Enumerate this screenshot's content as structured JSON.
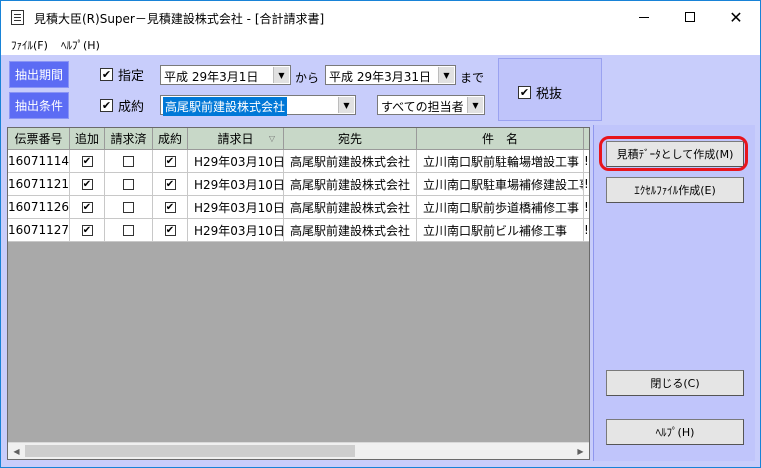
{
  "window": {
    "title": "見積大臣(R)Super－見積建設株式会社 - [合計請求書]"
  },
  "menu": {
    "file": "ﾌｧｲﾙ(F)",
    "help": "ﾍﾙﾌﾟ(H)"
  },
  "filters": {
    "period_label": "抽出期間",
    "condition_label": "抽出条件",
    "specify_label": "指定",
    "specify_checked": "✔",
    "from_date": "平成 29年3月1日",
    "from_text": "から",
    "to_date": "平成 29年3月31日",
    "until_text": "まで",
    "contract_label": "成約",
    "contract_checked": "✔",
    "customer": "高尾駅前建設株式会社",
    "staff": "すべての担当者",
    "tax_label": "税抜",
    "tax_checked": "✔"
  },
  "table": {
    "headers": [
      "伝票番号",
      "追加",
      "請求済",
      "成約",
      "請求日",
      "宛先",
      "件　名",
      ""
    ],
    "rows": [
      {
        "number": "16071114",
        "add": "✔",
        "billed": "",
        "contract": "✔",
        "date": "H29年03月10日",
        "recipient": "高尾駅前建設株式会社",
        "subject": "立川南口駅前駐輪場増設工事",
        "extra": "!"
      },
      {
        "number": "16071121",
        "add": "✔",
        "billed": "",
        "contract": "✔",
        "date": "H29年03月10日",
        "recipient": "高尾駅前建設株式会社",
        "subject": "立川南口駅駐車場補修建設工事",
        "extra": "!"
      },
      {
        "number": "16071126",
        "add": "✔",
        "billed": "",
        "contract": "✔",
        "date": "H29年03月10日",
        "recipient": "高尾駅前建設株式会社",
        "subject": "立川南口駅前歩道橋補修工事",
        "extra": "!"
      },
      {
        "number": "16071127",
        "add": "✔",
        "billed": "",
        "contract": "✔",
        "date": "H29年03月10日",
        "recipient": "高尾駅前建設株式会社",
        "subject": "立川南口駅前ビル補修工事",
        "extra": "!"
      }
    ]
  },
  "buttons": {
    "create_estimate": "見積ﾃﾞｰﾀとして作成(M)",
    "create_excel": "ｴｸｾﾙﾌｧｲﾙ作成(E)",
    "close": "閉じる(C)",
    "help": "ﾍﾙﾌﾟ(H)"
  },
  "colors": {
    "accent_blue": "#5c6cf4",
    "panel": "#c8cdfb",
    "highlight": "#e8141c"
  }
}
